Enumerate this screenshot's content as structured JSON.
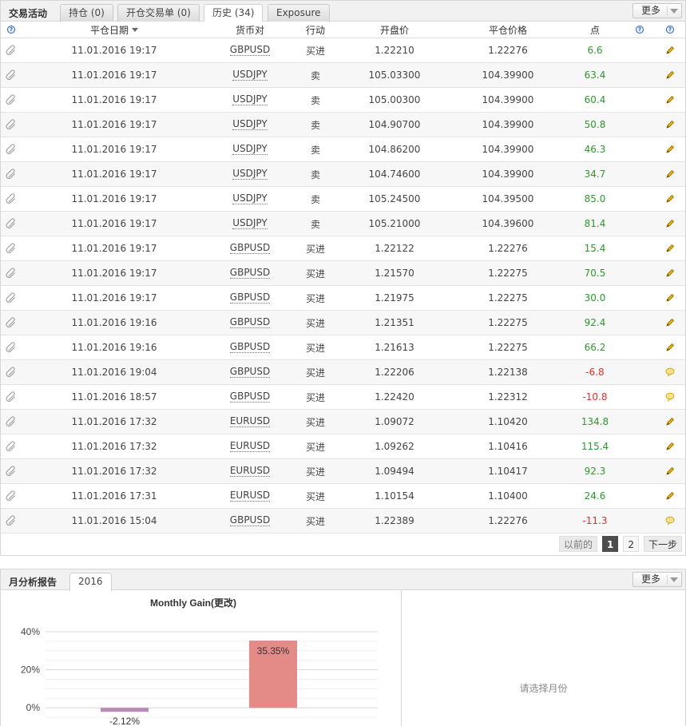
{
  "trade": {
    "title": "交易活动",
    "tabs": [
      {
        "label": "持仓 (0)"
      },
      {
        "label": "开仓交易单 (0)"
      },
      {
        "label": "历史 (34)"
      },
      {
        "label": "Exposure"
      }
    ],
    "more_label": "更多",
    "columns": {
      "date": "平仓日期",
      "pair": "货币对",
      "action": "行动",
      "open": "开盘价",
      "close": "平仓价格",
      "points": "点"
    },
    "rows": [
      {
        "date": "11.01.2016 19:17",
        "pair": "GBPUSD",
        "action": "买进",
        "open": "1.22210",
        "close": "1.22276",
        "points": "6.6"
      },
      {
        "date": "11.01.2016 19:17",
        "pair": "USDJPY",
        "action": "卖",
        "open": "105.03300",
        "close": "104.39900",
        "points": "63.4"
      },
      {
        "date": "11.01.2016 19:17",
        "pair": "USDJPY",
        "action": "卖",
        "open": "105.00300",
        "close": "104.39900",
        "points": "60.4"
      },
      {
        "date": "11.01.2016 19:17",
        "pair": "USDJPY",
        "action": "卖",
        "open": "104.90700",
        "close": "104.39900",
        "points": "50.8"
      },
      {
        "date": "11.01.2016 19:17",
        "pair": "USDJPY",
        "action": "卖",
        "open": "104.86200",
        "close": "104.39900",
        "points": "46.3"
      },
      {
        "date": "11.01.2016 19:17",
        "pair": "USDJPY",
        "action": "卖",
        "open": "104.74600",
        "close": "104.39900",
        "points": "34.7"
      },
      {
        "date": "11.01.2016 19:17",
        "pair": "USDJPY",
        "action": "卖",
        "open": "105.24500",
        "close": "104.39500",
        "points": "85.0"
      },
      {
        "date": "11.01.2016 19:17",
        "pair": "USDJPY",
        "action": "卖",
        "open": "105.21000",
        "close": "104.39600",
        "points": "81.4"
      },
      {
        "date": "11.01.2016 19:17",
        "pair": "GBPUSD",
        "action": "买进",
        "open": "1.22122",
        "close": "1.22276",
        "points": "15.4"
      },
      {
        "date": "11.01.2016 19:17",
        "pair": "GBPUSD",
        "action": "买进",
        "open": "1.21570",
        "close": "1.22275",
        "points": "70.5"
      },
      {
        "date": "11.01.2016 19:17",
        "pair": "GBPUSD",
        "action": "买进",
        "open": "1.21975",
        "close": "1.22275",
        "points": "30.0"
      },
      {
        "date": "11.01.2016 19:16",
        "pair": "GBPUSD",
        "action": "买进",
        "open": "1.21351",
        "close": "1.22275",
        "points": "92.4"
      },
      {
        "date": "11.01.2016 19:16",
        "pair": "GBPUSD",
        "action": "买进",
        "open": "1.21613",
        "close": "1.22275",
        "points": "66.2"
      },
      {
        "date": "11.01.2016 19:04",
        "pair": "GBPUSD",
        "action": "买进",
        "open": "1.22206",
        "close": "1.22138",
        "points": "-6.8"
      },
      {
        "date": "11.01.2016 18:57",
        "pair": "GBPUSD",
        "action": "买进",
        "open": "1.22420",
        "close": "1.22312",
        "points": "-10.8"
      },
      {
        "date": "11.01.2016 17:32",
        "pair": "EURUSD",
        "action": "买进",
        "open": "1.09072",
        "close": "1.10420",
        "points": "134.8"
      },
      {
        "date": "11.01.2016 17:32",
        "pair": "EURUSD",
        "action": "买进",
        "open": "1.09262",
        "close": "1.10416",
        "points": "115.4"
      },
      {
        "date": "11.01.2016 17:32",
        "pair": "EURUSD",
        "action": "买进",
        "open": "1.09494",
        "close": "1.10417",
        "points": "92.3"
      },
      {
        "date": "11.01.2016 17:31",
        "pair": "EURUSD",
        "action": "买进",
        "open": "1.10154",
        "close": "1.10400",
        "points": "24.6"
      },
      {
        "date": "11.01.2016 15:04",
        "pair": "GBPUSD",
        "action": "买进",
        "open": "1.22389",
        "close": "1.22276",
        "points": "-11.3"
      }
    ],
    "pagination": {
      "prev": "以前的",
      "pages": [
        "1",
        "2"
      ],
      "current": "1",
      "next": "下一步"
    }
  },
  "monthly": {
    "title": "月分析报告",
    "tabs": [
      {
        "label": "2016"
      }
    ],
    "more_label": "更多",
    "select_month_text": "请选择月份"
  },
  "colors": {
    "positive": "#2a9a2a",
    "negative": "#d9312c",
    "bar_positive": "#e58b87",
    "bar_negative": "#b88ab8"
  },
  "chart_data": {
    "type": "bar",
    "title": "Monthly Gain(更改)",
    "categories": [
      "",
      ""
    ],
    "values": [
      -2.12,
      35.35
    ],
    "value_labels": [
      "-2.12%",
      "35.35%"
    ],
    "ytick_labels": [
      "40%",
      "20%",
      "0%"
    ],
    "ylim": [
      -10,
      40
    ],
    "grid": true,
    "xlabel": "",
    "ylabel": ""
  }
}
